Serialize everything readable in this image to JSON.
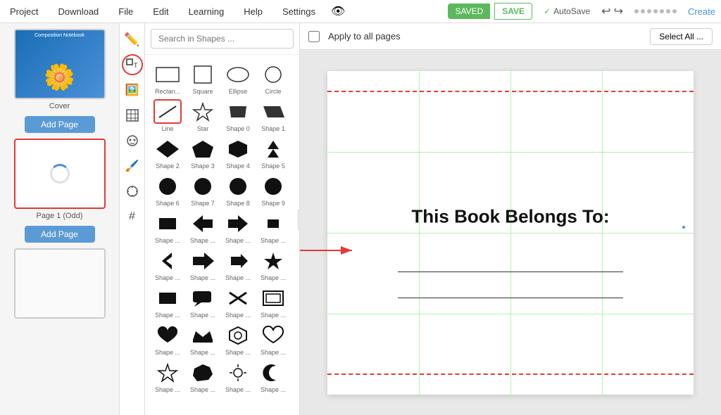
{
  "menuBar": {
    "items": [
      "Project",
      "Download",
      "File",
      "Edit",
      "Learning",
      "Help",
      "Settings"
    ],
    "savedLabel": "SAVED",
    "saveLabel": "SAVE",
    "autoSaveLabel": "AutoSave",
    "createLabel": "Create"
  },
  "toolbar": {
    "applyLabel": "Apply to all pages",
    "selectAllLabel": "Select All ..."
  },
  "shapesPanel": {
    "searchPlaceholder": "Search in Shapes ...",
    "shapes": [
      {
        "label": "Rectan...",
        "type": "rectangle"
      },
      {
        "label": "Square",
        "type": "square"
      },
      {
        "label": "Ellipse",
        "type": "ellipse"
      },
      {
        "label": "Circle",
        "type": "circle"
      },
      {
        "label": "Line",
        "type": "line"
      },
      {
        "label": "Star",
        "type": "star"
      },
      {
        "label": "Shape 0",
        "type": "trapezoid"
      },
      {
        "label": "Shape 1",
        "type": "parallelogram"
      },
      {
        "label": "Shape 2",
        "type": "diamond"
      },
      {
        "label": "Shape 3",
        "type": "pentagon"
      },
      {
        "label": "Shape 4",
        "type": "hexagon"
      },
      {
        "label": "Shape 5",
        "type": "arrow-up"
      },
      {
        "label": "Shape 6",
        "type": "circle-filled"
      },
      {
        "label": "Shape 7",
        "type": "circle-filled2"
      },
      {
        "label": "Shape 8",
        "type": "circle-filled3"
      },
      {
        "label": "Shape 9",
        "type": "circle-filled4"
      },
      {
        "label": "Shape ...",
        "type": "square-filled"
      },
      {
        "label": "Shape ...",
        "type": "arrow-left"
      },
      {
        "label": "Shape ...",
        "type": "arrow-right"
      },
      {
        "label": "Shape ...",
        "type": "small-square"
      },
      {
        "label": "Shape ...",
        "type": "chevron-left"
      },
      {
        "label": "Shape ...",
        "type": "chevron-right"
      },
      {
        "label": "Shape ...",
        "type": "arrow-right2"
      },
      {
        "label": "Shape ...",
        "type": "star2"
      },
      {
        "label": "Shape ...",
        "type": "square-sm"
      },
      {
        "label": "Shape ...",
        "type": "speech-bubble"
      },
      {
        "label": "Shape ...",
        "type": "cross"
      },
      {
        "label": "Shape ...",
        "type": "frame"
      },
      {
        "label": "Shape ...",
        "type": "heart"
      },
      {
        "label": "Shape ...",
        "type": "crown"
      },
      {
        "label": "Shape ...",
        "type": "hexagon2"
      },
      {
        "label": "Shape ...",
        "type": "heart2"
      },
      {
        "label": "Shape ...",
        "type": "star3"
      },
      {
        "label": "Shape ...",
        "type": "blob"
      },
      {
        "label": "Shape ...",
        "type": "sun"
      },
      {
        "label": "Shape ...",
        "type": "crescent"
      }
    ]
  },
  "pages": [
    {
      "id": "cover",
      "label": "Cover"
    },
    {
      "id": "page1",
      "label": "Page 1 (Odd)"
    }
  ],
  "addPageLabel": "Add Page",
  "canvas": {
    "title": "This Book Belongs To:"
  }
}
